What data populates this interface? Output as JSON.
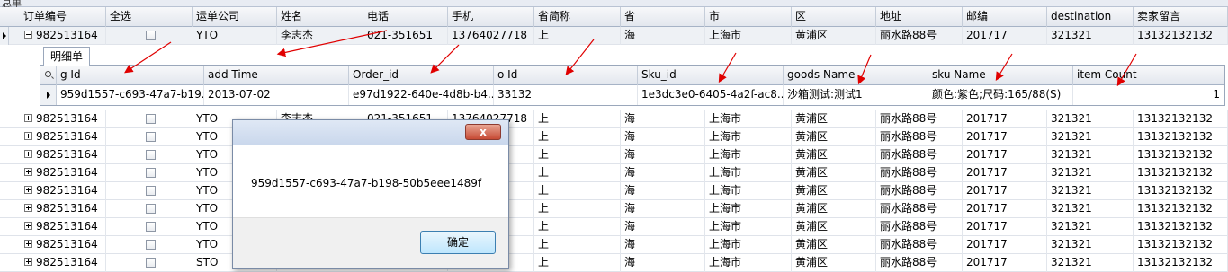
{
  "window": {
    "title_fragment": "总单"
  },
  "main": {
    "columns": [
      "订单编号",
      "全选",
      "运单公司",
      "姓名",
      "电话",
      "手机",
      "省简称",
      "省",
      "市",
      "区",
      "地址",
      "邮编",
      "destination",
      "卖家留言"
    ],
    "rows": [
      [
        "982513164",
        "",
        "YTO",
        "李志杰",
        "021-351651",
        "13764027718",
        "上",
        "海",
        "上海市",
        "黄浦区",
        "丽水路88号",
        "201717",
        "321321",
        "13132132132"
      ],
      [
        "982513164",
        "",
        "YTO",
        "李志杰",
        "021-351651",
        "13764027718",
        "上",
        "海",
        "上海市",
        "黄浦区",
        "丽水路88号",
        "201717",
        "321321",
        "13132132132"
      ],
      [
        "982513164",
        "",
        "YTO",
        "",
        "",
        "18",
        "上",
        "海",
        "上海市",
        "黄浦区",
        "丽水路88号",
        "201717",
        "321321",
        "13132132132"
      ],
      [
        "982513164",
        "",
        "YTO",
        "",
        "",
        "18",
        "上",
        "海",
        "上海市",
        "黄浦区",
        "丽水路88号",
        "201717",
        "321321",
        "13132132132"
      ],
      [
        "982513164",
        "",
        "YTO",
        "",
        "",
        "18",
        "上",
        "海",
        "上海市",
        "黄浦区",
        "丽水路88号",
        "201717",
        "321321",
        "13132132132"
      ],
      [
        "982513164",
        "",
        "YTO",
        "",
        "",
        "18",
        "上",
        "海",
        "上海市",
        "黄浦区",
        "丽水路88号",
        "201717",
        "321321",
        "13132132132"
      ],
      [
        "982513164",
        "",
        "YTO",
        "",
        "",
        "18",
        "上",
        "海",
        "上海市",
        "黄浦区",
        "丽水路88号",
        "201717",
        "321321",
        "13132132132"
      ],
      [
        "982513164",
        "",
        "YTO",
        "",
        "",
        "18",
        "上",
        "海",
        "上海市",
        "黄浦区",
        "丽水路88号",
        "201717",
        "321321",
        "13132132132"
      ],
      [
        "982513164",
        "",
        "YTO",
        "",
        "",
        "18",
        "上",
        "海",
        "上海市",
        "黄浦区",
        "丽水路88号",
        "201717",
        "321321",
        "13132132132"
      ],
      [
        "982513164",
        "",
        "STO",
        "",
        "",
        "18",
        "上",
        "海",
        "上海市",
        "黄浦区",
        "丽水路88号",
        "201717",
        "321321",
        "13132132132"
      ]
    ]
  },
  "detail": {
    "tab_label": "明细单",
    "columns": [
      "g Id",
      "add Time",
      "Order_id",
      "o Id",
      "Sku_id",
      "goods Name",
      "sku Name",
      "item Count"
    ],
    "row": [
      "959d1557-c693-47a7-b19...",
      "2013-07-02",
      "e97d1922-640e-4d8b-b4...",
      "33132",
      "1e3dc3e0-6405-4a2f-ac8...",
      "沙箱测试:测试1",
      "颜色:紫色;尺码:165/88(S)",
      "1"
    ]
  },
  "dialog": {
    "message": "959d1557-c693-47a7-b198-50b5eee1489f",
    "ok_label": "确定",
    "close_label": "x"
  },
  "colors": {
    "arrow": "#e00000",
    "header_bg": "#e3e7ee",
    "dialog_ok": "#bee6fd"
  }
}
